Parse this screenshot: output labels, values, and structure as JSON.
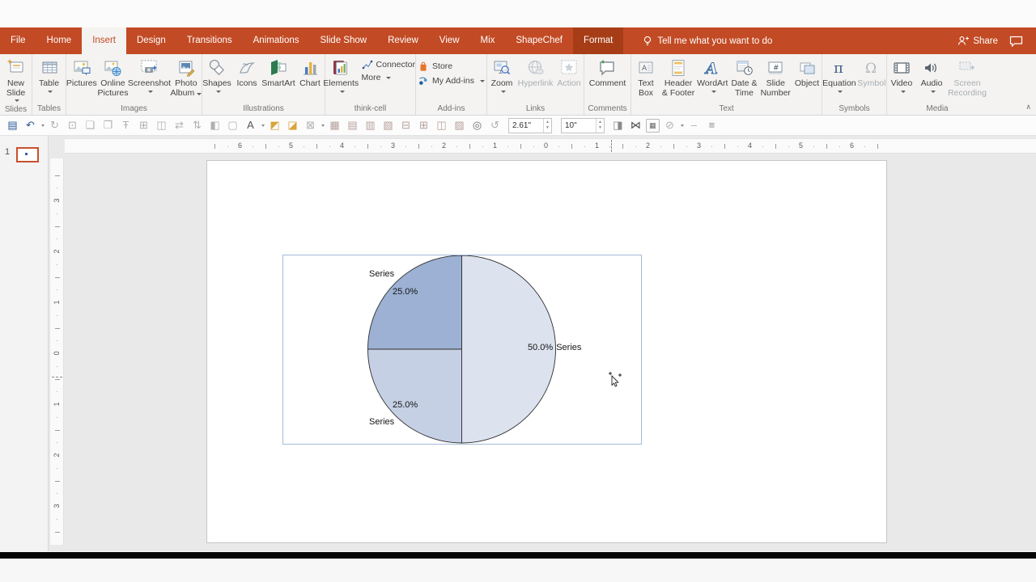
{
  "window": {
    "tell_me": "Tell me what you want to do",
    "share_label": "Share"
  },
  "tabbar": {
    "tabs": [
      {
        "label": "File",
        "state": "normal"
      },
      {
        "label": "Home",
        "state": "normal"
      },
      {
        "label": "Insert",
        "state": "active"
      },
      {
        "label": "Design",
        "state": "normal"
      },
      {
        "label": "Transitions",
        "state": "normal"
      },
      {
        "label": "Animations",
        "state": "normal"
      },
      {
        "label": "Slide Show",
        "state": "normal"
      },
      {
        "label": "Review",
        "state": "normal"
      },
      {
        "label": "View",
        "state": "normal"
      },
      {
        "label": "Mix",
        "state": "normal"
      },
      {
        "label": "ShapeChef",
        "state": "normal"
      },
      {
        "label": "Format",
        "state": "contextual"
      }
    ]
  },
  "ribbon": {
    "slides": {
      "name": "Slides",
      "new_slide": [
        "New",
        "Slide"
      ]
    },
    "tables": {
      "name": "Tables",
      "table": "Table"
    },
    "images": {
      "name": "Images",
      "pictures": "Pictures",
      "online": [
        "Online",
        "Pictures"
      ],
      "screenshot": "Screenshot",
      "album": [
        "Photo",
        "Album"
      ]
    },
    "illustrations": {
      "name": "Illustrations",
      "shapes": "Shapes",
      "icons": "Icons",
      "smartart": "SmartArt",
      "chart": "Chart"
    },
    "thinkcell": {
      "name": "think-cell",
      "elements": "Elements",
      "connector": "Connector",
      "more": "More"
    },
    "addins": {
      "name": "Add-ins",
      "store": "Store",
      "my_addins": "My Add-ins"
    },
    "links": {
      "name": "Links",
      "zoom": "Zoom",
      "hyperlink": "Hyperlink",
      "action": "Action"
    },
    "comments": {
      "name": "Comments",
      "comment": "Comment"
    },
    "text": {
      "name": "Text",
      "text_box": [
        "Text",
        "Box"
      ],
      "header_footer": [
        "Header",
        "& Footer"
      ],
      "wordart": "WordArt",
      "date_time": [
        "Date &",
        "Time"
      ],
      "slide_number": [
        "Slide",
        "Number"
      ],
      "object": "Object"
    },
    "symbols": {
      "name": "Symbols",
      "equation": "Equation",
      "symbol": "Symbol"
    },
    "media": {
      "name": "Media",
      "video": "Video",
      "audio": "Audio",
      "screen_recording": [
        "Screen",
        "Recording"
      ]
    }
  },
  "qat": {
    "items": [
      {
        "type": "icon",
        "name": "save-icon",
        "glyph": "▤",
        "color": "#2b579a",
        "enabled": true
      },
      {
        "type": "icon",
        "name": "undo-icon",
        "glyph": "↶",
        "color": "#2b579a",
        "dd": true,
        "enabled": true
      },
      {
        "type": "icon",
        "name": "redo-icon",
        "glyph": "↻",
        "color": "#b0b0b0",
        "enabled": false
      },
      {
        "type": "icon",
        "name": "start-slideshow-icon",
        "glyph": "⊡",
        "color": "#b0b0b0",
        "enabled": false
      },
      {
        "type": "icon",
        "name": "duplicate-slide-icon",
        "glyph": "❏",
        "color": "#b0b0b0",
        "enabled": false
      },
      {
        "type": "icon",
        "name": "export-slide-icon",
        "glyph": "❐",
        "color": "#b0b0b0",
        "enabled": false
      },
      {
        "type": "icon",
        "name": "font-scale-icon",
        "glyph": "Ŧ",
        "color": "#b0b0b0",
        "enabled": false
      },
      {
        "type": "icon",
        "name": "insert-chart-icon",
        "glyph": "⊞",
        "color": "#b0b0b0",
        "enabled": false
      },
      {
        "type": "icon",
        "name": "print-icon",
        "glyph": "◫",
        "color": "#b0b0b0",
        "enabled": false
      },
      {
        "type": "icon",
        "name": "resize-width-icon",
        "glyph": "⇄",
        "color": "#b0b0b0",
        "enabled": false
      },
      {
        "type": "icon",
        "name": "resize-height-icon",
        "glyph": "⇅",
        "color": "#b0b0b0",
        "enabled": false
      },
      {
        "type": "icon",
        "name": "print-preview-icon",
        "glyph": "◧",
        "color": "#b0b0b0",
        "enabled": false
      },
      {
        "type": "icon",
        "name": "selection-marquee-icon",
        "glyph": "▢",
        "color": "#b0b0b0",
        "enabled": false
      },
      {
        "type": "icon",
        "name": "shadow-text-icon",
        "glyph": "A",
        "color": "#555555",
        "dd": true,
        "enabled": true
      },
      {
        "type": "icon",
        "name": "bring-forward-icon",
        "glyph": "◩",
        "color": "#d9a43b",
        "enabled": true
      },
      {
        "type": "icon",
        "name": "send-backward-icon",
        "glyph": "◪",
        "color": "#d9a43b",
        "enabled": true
      },
      {
        "type": "icon",
        "name": "delete-element-icon",
        "glyph": "⊠",
        "color": "#b0b0b0",
        "dd": true,
        "enabled": false
      },
      {
        "type": "icon",
        "name": "table-style-1-icon",
        "glyph": "▦",
        "color": "#b7a09a",
        "enabled": false
      },
      {
        "type": "icon",
        "name": "table-style-2-icon",
        "glyph": "▤",
        "color": "#b7a09a",
        "enabled": false
      },
      {
        "type": "icon",
        "name": "table-style-3-icon",
        "glyph": "▥",
        "color": "#b7a09a",
        "enabled": false
      },
      {
        "type": "icon",
        "name": "table-style-4-icon",
        "glyph": "▧",
        "color": "#b7a09a",
        "enabled": false
      },
      {
        "type": "icon",
        "name": "table-rows-icon",
        "glyph": "⊟",
        "color": "#b7a09a",
        "enabled": false
      },
      {
        "type": "icon",
        "name": "table-columns-icon",
        "glyph": "⊞",
        "color": "#b7a09a",
        "enabled": false
      },
      {
        "type": "icon",
        "name": "table-split-icon",
        "glyph": "◫",
        "color": "#b7a09a",
        "enabled": false
      },
      {
        "type": "icon",
        "name": "table-shade-icon",
        "glyph": "▨",
        "color": "#b7a09a",
        "enabled": false
      },
      {
        "type": "icon",
        "name": "crop-fit-icon",
        "glyph": "◎",
        "color": "#6a6a6a",
        "enabled": true
      },
      {
        "type": "icon",
        "name": "rotate-object-icon",
        "glyph": "↺",
        "color": "#b0b0b0",
        "enabled": false
      },
      {
        "type": "field",
        "name": "width-field",
        "value": "2.61\""
      },
      {
        "type": "field",
        "name": "height-field",
        "value": "10\""
      },
      {
        "type": "icon",
        "name": "merge-shapes-icon",
        "glyph": "◨",
        "color": "#8a8a8a",
        "enabled": true
      },
      {
        "type": "icon",
        "name": "flip-shape-icon",
        "glyph": "⋈",
        "color": "#4a4a4a",
        "enabled": true
      },
      {
        "type": "icon",
        "name": "chart-frame-icon",
        "glyph": "▦",
        "color": "#666666",
        "boxed": true,
        "enabled": true
      },
      {
        "type": "icon",
        "name": "no-outline-icon",
        "glyph": "⊘",
        "color": "#b0b0b0",
        "dd": true,
        "enabled": false
      },
      {
        "type": "icon",
        "name": "dash-icon",
        "glyph": "‒",
        "color": "#b0b0b0",
        "enabled": false
      },
      {
        "type": "icon",
        "name": "toolbar-overflow-icon",
        "glyph": "≡",
        "color": "#8a8a8a",
        "enabled": true
      }
    ]
  },
  "rulers": {
    "horizontal": [
      "6",
      "5",
      "4",
      "3",
      "2",
      "1",
      "0",
      "1",
      "2",
      "3",
      "4",
      "5",
      "6"
    ],
    "vertical": [
      "3",
      "2",
      "1",
      "0",
      "1",
      "2",
      "3"
    ]
  },
  "slide_panel": {
    "number": "1"
  },
  "pie_labels": {
    "top_name": "Series",
    "top_pct": "25.0%",
    "right_pct": "50.0%",
    "right_name": "Series",
    "bottom_pct": "25.0%",
    "bottom_name": "Series"
  },
  "chart_data": {
    "type": "pie",
    "title": "",
    "series_name": "Series",
    "slices": [
      {
        "label": "Series",
        "value": 50.0,
        "display": "50.0%",
        "color": "#dce3ef",
        "position": "right half"
      },
      {
        "label": "Series",
        "value": 25.0,
        "display": "25.0%",
        "color": "#c5d0e5",
        "position": "bottom-left quadrant"
      },
      {
        "label": "Series",
        "value": 25.0,
        "display": "25.0%",
        "color": "#9cb1d3",
        "position": "top-left quadrant"
      }
    ],
    "start_angle_deg": 0,
    "direction": "clockwise",
    "legend": "none",
    "labels_shown": "percentage and series name"
  }
}
